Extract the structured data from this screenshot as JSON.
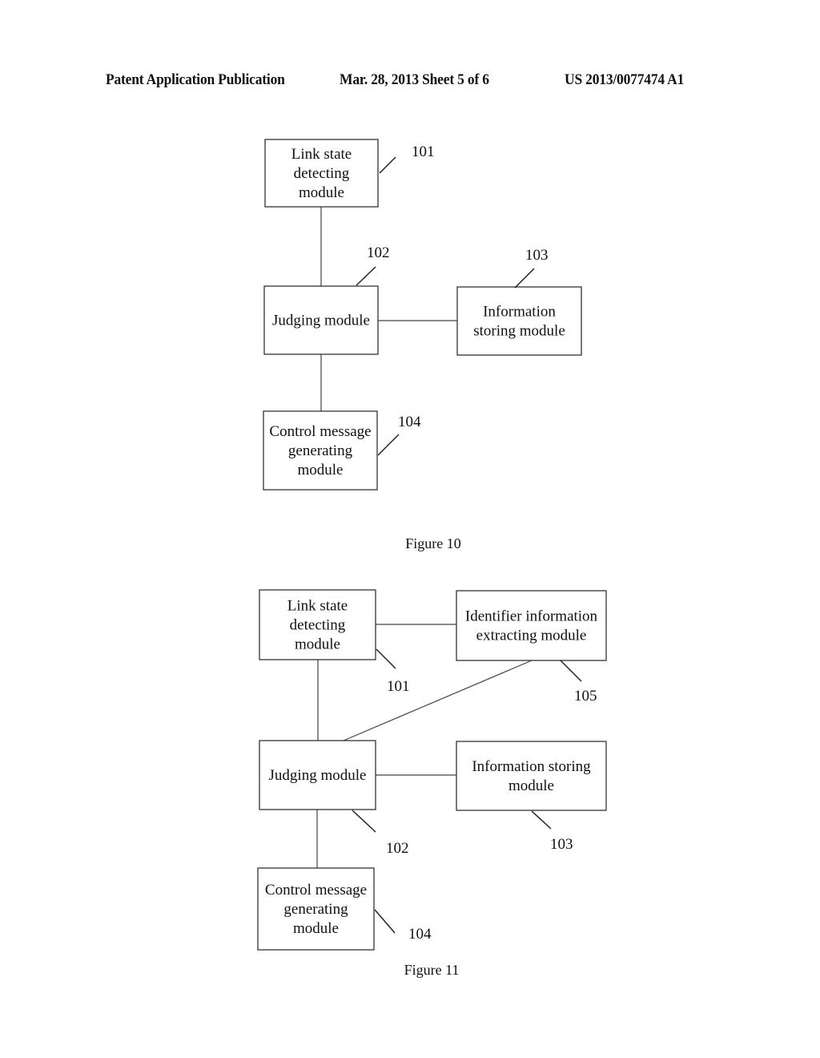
{
  "header": {
    "left": "Patent Application Publication",
    "center": "Mar. 28, 2013  Sheet 5 of 6",
    "right": "US 2013/0077474 A1"
  },
  "figures": [
    {
      "caption": "Figure 10",
      "modules": [
        {
          "id": "101",
          "lines": [
            "Link state",
            "detecting",
            "module"
          ]
        },
        {
          "id": "102",
          "lines": [
            "Judging module"
          ]
        },
        {
          "id": "103",
          "lines": [
            "Information",
            "storing module"
          ]
        },
        {
          "id": "104",
          "lines": [
            "Control message",
            "generating",
            "module"
          ]
        }
      ],
      "connections": [
        [
          "101",
          "102"
        ],
        [
          "102",
          "103"
        ],
        [
          "102",
          "104"
        ]
      ]
    },
    {
      "caption": "Figure 11",
      "modules": [
        {
          "id": "101",
          "lines": [
            "Link state",
            "detecting",
            "module"
          ]
        },
        {
          "id": "105",
          "lines": [
            "Identifier information",
            "extracting module"
          ]
        },
        {
          "id": "102",
          "lines": [
            "Judging module"
          ]
        },
        {
          "id": "103",
          "lines": [
            "Information storing",
            "module"
          ]
        },
        {
          "id": "104",
          "lines": [
            "Control message",
            "generating",
            "module"
          ]
        }
      ],
      "connections": [
        [
          "101",
          "105"
        ],
        [
          "101",
          "102"
        ],
        [
          "105",
          "102"
        ],
        [
          "102",
          "103"
        ],
        [
          "102",
          "104"
        ]
      ]
    }
  ]
}
